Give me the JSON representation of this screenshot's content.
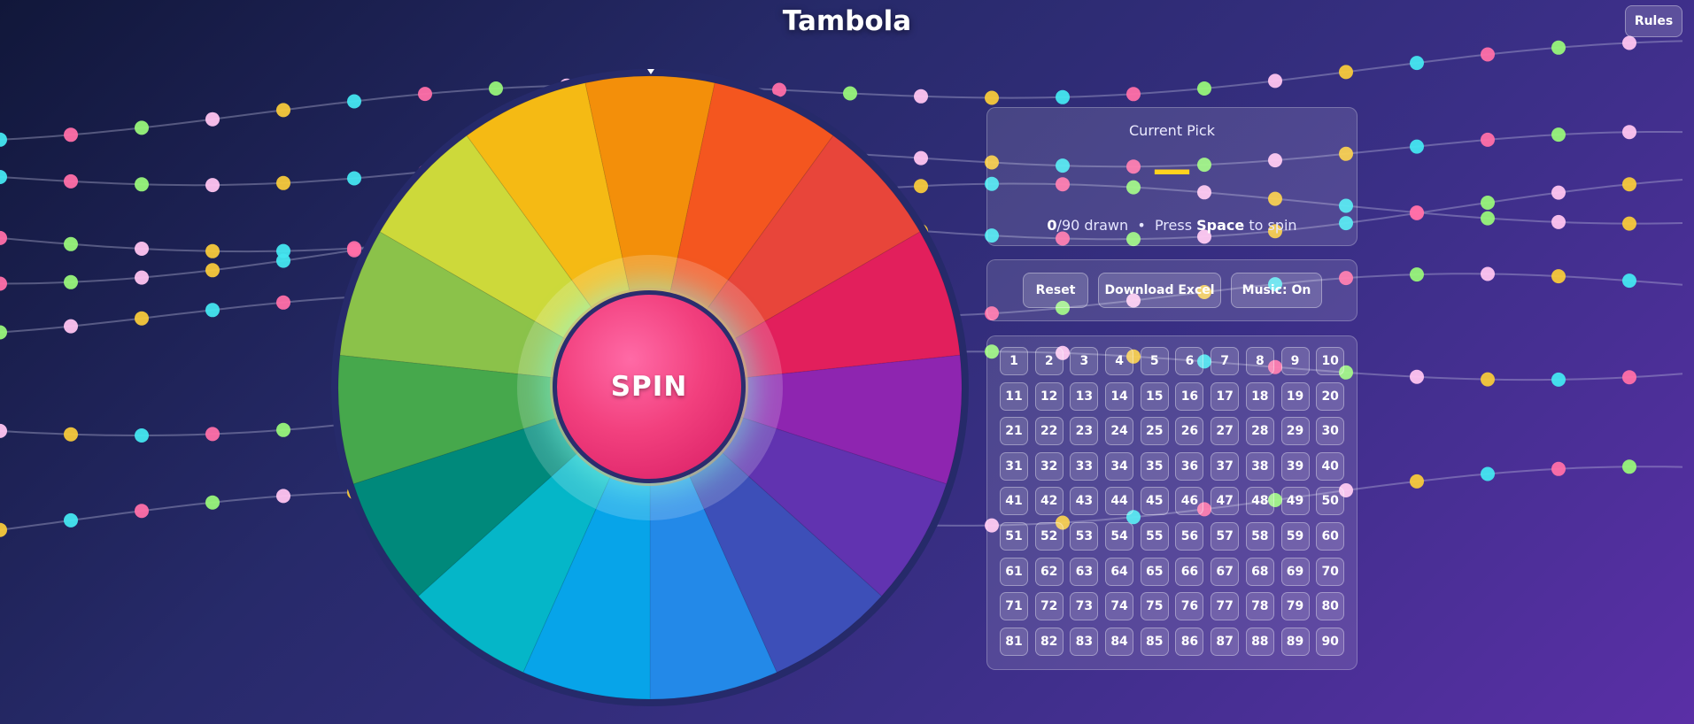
{
  "title": "Tambola",
  "rules_label": "Rules",
  "wheel": {
    "spin_label": "SPIN",
    "segment_colors": [
      "#f38f0a",
      "#f4561f",
      "#e8453a",
      "#e21f5c",
      "#8e25b0",
      "#6133b0",
      "#3d4fb8",
      "#2389e8",
      "#07a4e9",
      "#05b6c8",
      "#00897b",
      "#46a84c",
      "#8bc24a",
      "#cdd93a",
      "#f5ba14"
    ]
  },
  "current_pick": {
    "label": "Current Pick",
    "value": "—",
    "drawn": "0",
    "total_text": "/90 drawn",
    "separator": "•",
    "press_text": "Press",
    "key_text": "Space",
    "action_text": "to spin"
  },
  "controls": {
    "reset": "Reset",
    "download": "Download Excel",
    "music": "Music: On"
  },
  "numbers": [
    "1",
    "2",
    "3",
    "4",
    "5",
    "6",
    "7",
    "8",
    "9",
    "10",
    "11",
    "12",
    "13",
    "14",
    "15",
    "16",
    "17",
    "18",
    "19",
    "20",
    "21",
    "22",
    "23",
    "24",
    "25",
    "26",
    "27",
    "28",
    "29",
    "30",
    "31",
    "32",
    "33",
    "34",
    "35",
    "36",
    "37",
    "38",
    "39",
    "40",
    "41",
    "42",
    "43",
    "44",
    "45",
    "46",
    "47",
    "48",
    "49",
    "50",
    "51",
    "52",
    "53",
    "54",
    "55",
    "56",
    "57",
    "58",
    "59",
    "60",
    "61",
    "62",
    "63",
    "64",
    "65",
    "66",
    "67",
    "68",
    "69",
    "70",
    "71",
    "72",
    "73",
    "74",
    "75",
    "76",
    "77",
    "78",
    "79",
    "80",
    "81",
    "82",
    "83",
    "84",
    "85",
    "86",
    "87",
    "88",
    "89",
    "90"
  ],
  "light_colors": [
    "#45e6f0",
    "#ff6fa8",
    "#98f57a",
    "#ffc4f0",
    "#f7c93b"
  ]
}
